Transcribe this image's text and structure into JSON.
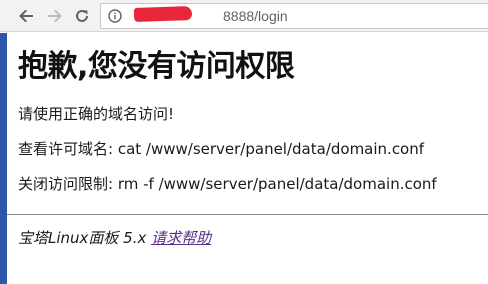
{
  "browser": {
    "back_icon": "arrow-left-icon",
    "forward_icon": "arrow-right-icon",
    "reload_icon": "reload-icon",
    "info_icon": "info-circle-icon",
    "url_host_visible": "8888",
    "url_path": "/login",
    "redaction_color": "#e8283a"
  },
  "page": {
    "title": "抱歉,您没有访问权限",
    "line1": "请使用正确的域名访问!",
    "line2": "查看许可域名: cat /www/server/panel/data/domain.conf",
    "line3": "关闭访问限制: rm -f /www/server/panel/data/domain.conf",
    "footer_text": "宝塔Linux面板 5.x ",
    "footer_link": "请求帮助",
    "accent_strip_color": "#2d57a8",
    "link_color": "#5a2f8c"
  }
}
